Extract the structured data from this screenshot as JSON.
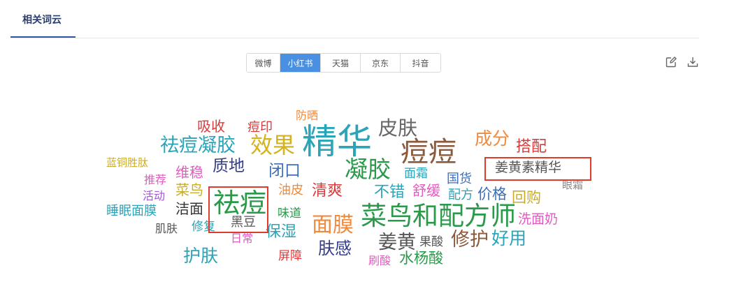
{
  "section": {
    "title": "相关词云"
  },
  "platform_tabs": [
    {
      "label": "微博",
      "active": false
    },
    {
      "label": "小红书",
      "active": true
    },
    {
      "label": "天猫",
      "active": false
    },
    {
      "label": "京东",
      "active": false
    },
    {
      "label": "抖音",
      "active": false
    }
  ],
  "toolbar": {
    "edit_icon": "edit-icon",
    "download_icon": "download-icon"
  },
  "wordcloud": {
    "words": [
      {
        "text": "吸收",
        "color": "#d93b3b"
      },
      {
        "text": "痘印",
        "color": "#d93b3b"
      },
      {
        "text": "防晒",
        "color": "#f08a3c"
      },
      {
        "text": "皮肤",
        "color": "#666666"
      },
      {
        "text": "祛痘凝胶",
        "color": "#2aa4b8"
      },
      {
        "text": "效果",
        "color": "#d6b21f"
      },
      {
        "text": "精华",
        "color": "#2aa4b8"
      },
      {
        "text": "痘痘",
        "color": "#8b5a3c"
      },
      {
        "text": "成分",
        "color": "#f08a3c"
      },
      {
        "text": "搭配",
        "color": "#d93b3b"
      },
      {
        "text": "蓝铜胜肽",
        "color": "#c8ad2b"
      },
      {
        "text": "质地",
        "color": "#333c8a"
      },
      {
        "text": "闭口",
        "color": "#3d6fb8"
      },
      {
        "text": "凝胶",
        "color": "#2a9a4a"
      },
      {
        "text": "面霜",
        "color": "#2aa4b8"
      },
      {
        "text": "国货",
        "color": "#3d6fb8"
      },
      {
        "text": "姜黄素精华",
        "color": "#555555"
      },
      {
        "text": "推荐",
        "color": "#e35ac0"
      },
      {
        "text": "维稳",
        "color": "#e35ac0"
      },
      {
        "text": "眼霜",
        "color": "#888888"
      },
      {
        "text": "菜鸟",
        "color": "#c8ad2b"
      },
      {
        "text": "活动",
        "color": "#a05ad0"
      },
      {
        "text": "油皮",
        "color": "#f08a3c"
      },
      {
        "text": "清爽",
        "color": "#d93b3b"
      },
      {
        "text": "不错",
        "color": "#2aa4b8"
      },
      {
        "text": "舒缓",
        "color": "#e35ac0"
      },
      {
        "text": "配方",
        "color": "#2aa4b8"
      },
      {
        "text": "价格",
        "color": "#3d6fb8"
      },
      {
        "text": "回购",
        "color": "#c8ad2b"
      },
      {
        "text": "睡眠面膜",
        "color": "#2aa4b8"
      },
      {
        "text": "洁面",
        "color": "#333333"
      },
      {
        "text": "祛痘",
        "color": "#2a9a4a"
      },
      {
        "text": "味道",
        "color": "#2a9a4a"
      },
      {
        "text": "肌肤",
        "color": "#555555"
      },
      {
        "text": "修复",
        "color": "#2aa4b8"
      },
      {
        "text": "黑豆",
        "color": "#555555"
      },
      {
        "text": "日常",
        "color": "#e35ac0"
      },
      {
        "text": "保湿",
        "color": "#2aa4b8"
      },
      {
        "text": "面膜",
        "color": "#f08a3c"
      },
      {
        "text": "菜鸟和配方师",
        "color": "#2a9a4a"
      },
      {
        "text": "洗面奶",
        "color": "#e35ac0"
      },
      {
        "text": "姜黄",
        "color": "#555555"
      },
      {
        "text": "果酸",
        "color": "#555555"
      },
      {
        "text": "修护",
        "color": "#8b5a3c"
      },
      {
        "text": "好用",
        "color": "#2aa4b8"
      },
      {
        "text": "护肤",
        "color": "#2aa4b8"
      },
      {
        "text": "屏障",
        "color": "#d93b3b"
      },
      {
        "text": "肤感",
        "color": "#333c8a"
      },
      {
        "text": "刷酸",
        "color": "#e35ac0"
      },
      {
        "text": "水杨酸",
        "color": "#2a9a4a"
      }
    ]
  }
}
